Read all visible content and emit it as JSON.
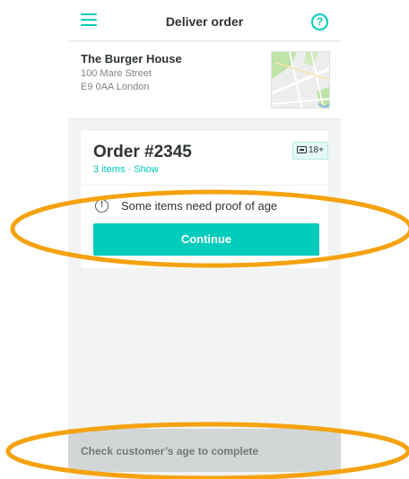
{
  "header": {
    "title": "Deliver order",
    "menu_icon": "hamburger-menu-icon",
    "help_icon": "question-mark-icon",
    "help_glyph": "?"
  },
  "restaurant": {
    "name": "The Burger House",
    "address_line1": "100 Mare Street",
    "address_line2": "E9 0AA London",
    "map_icon": "map-thumbnail"
  },
  "order": {
    "title": "Order #2345",
    "items_text": "3 items · Show",
    "age_badge": "18+",
    "alert_glyph": "!",
    "alert_text": "Some items need proof of age",
    "continue_label": "Continue"
  },
  "bottom_bar": {
    "text": "Check customer’s age to complete"
  },
  "colors": {
    "accent": "#00ccbc",
    "background": "#f2f3f3",
    "annotation": "#f5a20f",
    "disabled_bar": "#d2d6d6"
  }
}
